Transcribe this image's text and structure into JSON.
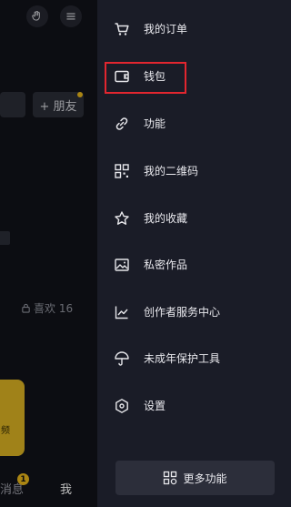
{
  "background": {
    "chips": {
      "add_friend": "+ 朋友"
    },
    "likes_label": "喜欢 16",
    "yellow_card_text": "频",
    "bottom_tabs": {
      "messages": "消息",
      "messages_badge": "1",
      "me": "我"
    }
  },
  "drawer": {
    "items": [
      {
        "label": "我的订单",
        "icon": "cart-icon"
      },
      {
        "label": "钱包",
        "icon": "wallet-icon",
        "highlighted": true
      },
      {
        "label": "功能",
        "icon": "link-icon"
      },
      {
        "label": "我的二维码",
        "icon": "qr-code-icon"
      },
      {
        "label": "我的收藏",
        "icon": "star-icon"
      },
      {
        "label": "私密作品",
        "icon": "image-icon"
      },
      {
        "label": "创作者服务中心",
        "icon": "chart-icon"
      },
      {
        "label": "未成年保护工具",
        "icon": "umbrella-icon"
      },
      {
        "label": "设置",
        "icon": "settings-icon"
      }
    ],
    "more_button_label": "更多功能"
  },
  "colors": {
    "drawer_bg": "#1a1c27",
    "highlight": "#e2262f",
    "accent_yellow": "#d6ae22"
  }
}
